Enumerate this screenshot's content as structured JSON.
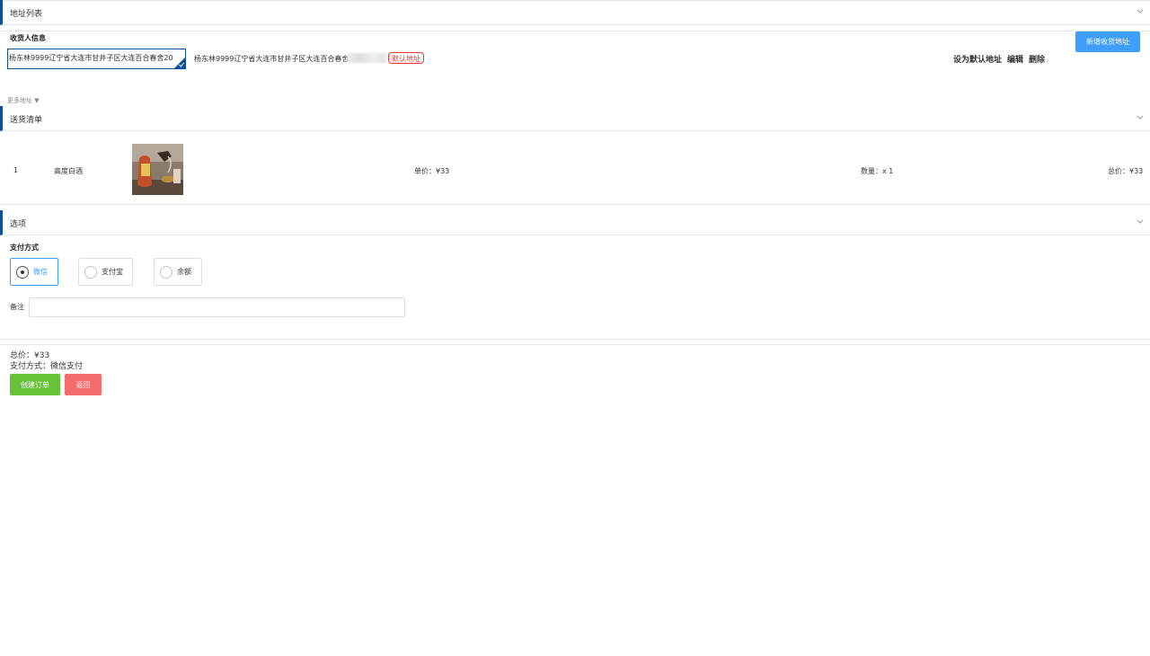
{
  "address_section": {
    "title": "地址列表",
    "receiver_label": "收货人信息",
    "selected_address": "杨东林9999辽宁省大连市甘井子区大连百合春舍20",
    "address_line": "杨东林9999辽宁省大连市甘井子区大连百合春舍20",
    "default_badge": "默认地址",
    "actions": {
      "set_default": "设为默认地址",
      "edit": "编辑",
      "delete": "删除"
    },
    "add_button": "新增收货地址",
    "more_addresses": "更多地址 ▼"
  },
  "goods_section": {
    "title": "送货清单",
    "items": [
      {
        "index": "1",
        "name": "高度白酒",
        "unit_price": "单价：¥33",
        "quantity": "数量：x 1",
        "total": "总价：¥33"
      }
    ]
  },
  "options_section": {
    "title": "选项",
    "payment_label": "支付方式",
    "payment_options": [
      "微信",
      "支付宝",
      "余额"
    ],
    "selected_payment": "微信",
    "remark_label": "备注",
    "remark_value": ""
  },
  "summary": {
    "total": "总价：¥33",
    "payment_method": "支付方式：微信支付",
    "create_button": "创建订单",
    "back_button": "返回"
  },
  "colors": {
    "accent_blue": "#409eff",
    "nav_blue": "#0d4f9c",
    "success_green": "#67c23a",
    "danger_red": "#f56c6c"
  }
}
